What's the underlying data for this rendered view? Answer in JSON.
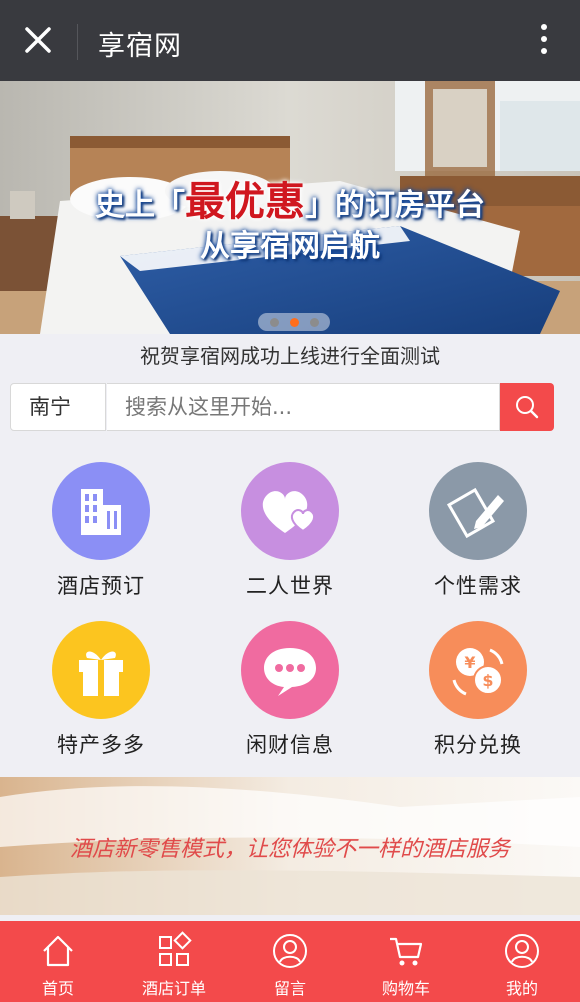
{
  "topbar": {
    "title": "享宿网",
    "close_icon": "close-icon",
    "more_icon": "more-vertical-icon"
  },
  "banner": {
    "headline_pre": "史上「",
    "headline_highlight": "最优惠",
    "headline_post": "」的订房平台",
    "subline": "从享宿网启航",
    "active_slide": 2,
    "slide_count": 3
  },
  "notice": "祝贺享宿网成功上线进行全面测试",
  "search": {
    "city": "南宁",
    "placeholder": "搜索从这里开始...",
    "icon": "search-icon"
  },
  "grid": [
    {
      "label": "酒店预订",
      "icon": "building-icon",
      "color": "#8b8ff5"
    },
    {
      "label": "二人世界",
      "icon": "hearts-icon",
      "color": "#c78fe0"
    },
    {
      "label": "个性需求",
      "icon": "pencil-note-icon",
      "color": "#8b99a8"
    },
    {
      "label": "特产多多",
      "icon": "gift-icon",
      "color": "#fcc51f"
    },
    {
      "label": "闲财信息",
      "icon": "chat-bubble-icon",
      "color": "#f06ba0"
    },
    {
      "label": "积分兑换",
      "icon": "currency-exchange-icon",
      "color": "#f78d5a"
    }
  ],
  "ad": {
    "text": "酒店新零售模式，让您体验不一样的酒店服务"
  },
  "tabbar": [
    {
      "label": "首页",
      "icon": "home-icon"
    },
    {
      "label": "酒店订单",
      "icon": "orders-grid-icon"
    },
    {
      "label": "留言",
      "icon": "user-circle-icon"
    },
    {
      "label": "购物车",
      "icon": "cart-icon"
    },
    {
      "label": "我的",
      "icon": "profile-icon"
    }
  ],
  "colors": {
    "accent": "#f34a4b",
    "topbar": "#393a3f",
    "background": "#efeff4"
  }
}
